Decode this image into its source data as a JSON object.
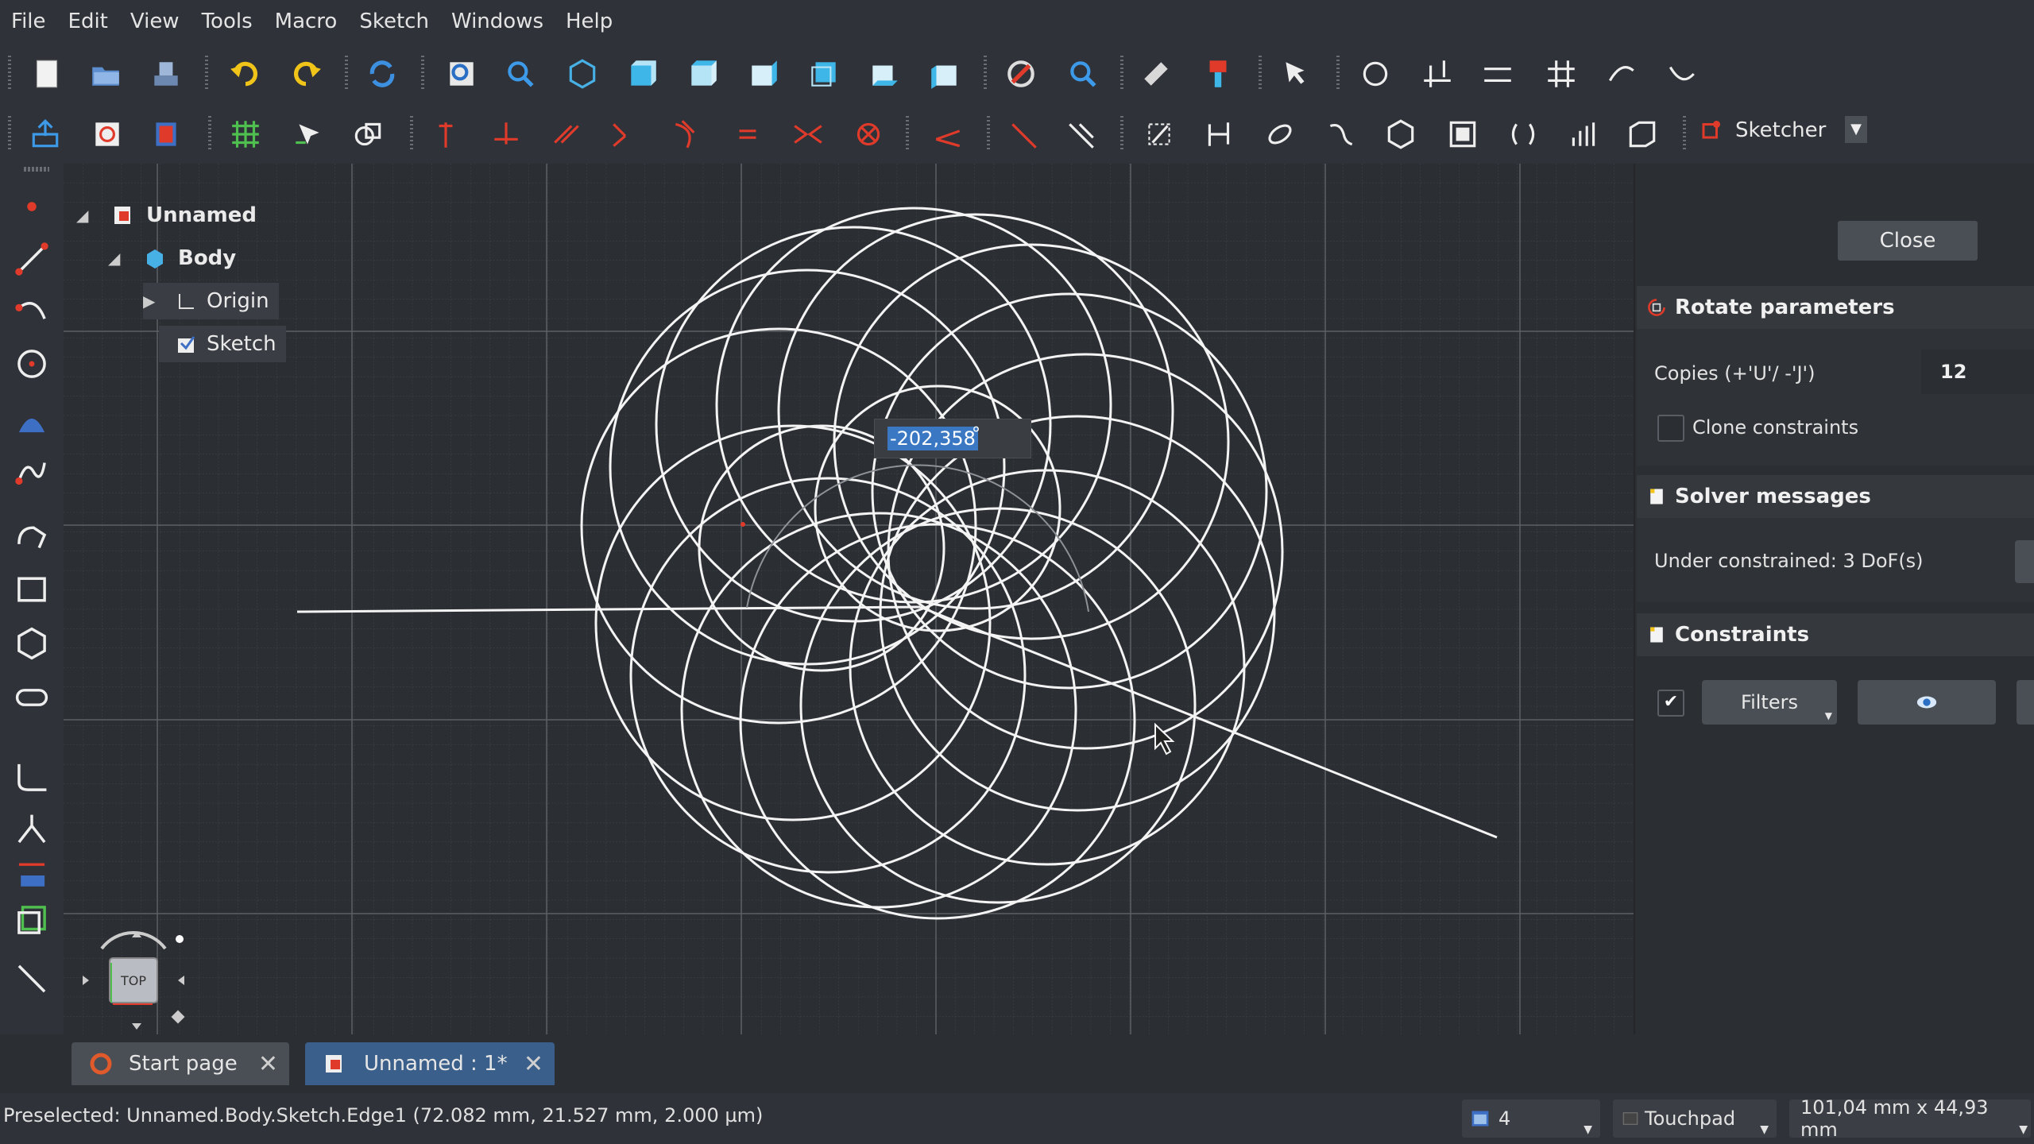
{
  "menubar": {
    "items": [
      "File",
      "Edit",
      "View",
      "Tools",
      "Macro",
      "Sketch",
      "Windows",
      "Help"
    ]
  },
  "toolbar": {
    "workbench": "Sketcher",
    "icons_row1": [
      "new-file-icon",
      "open-file-icon",
      "save-file-icon",
      "undo-icon",
      "redo-icon",
      "refresh-icon",
      "fit-all-icon",
      "fit-selection-icon",
      "isometric-view-icon",
      "front-view-icon",
      "top-view-icon",
      "right-view-icon",
      "rear-view-icon",
      "bottom-view-icon",
      "left-view-icon",
      "draw-style-icon",
      "bounding-box-icon",
      "measure-icon",
      "part-icon",
      "whats-this-icon",
      "constrain-icons"
    ],
    "icons_row2": [
      "leave-sketch-icon",
      "view-sketch-icon",
      "view-section-icon",
      "toggle-grid-icon",
      "toggle-snap-icon",
      "rendering-order-icon",
      "coincident-icon",
      "point-on-object-icon",
      "horizontal-icon",
      "vertical-icon",
      "parallel-icon",
      "perpendicular-icon",
      "tangent-icon",
      "equal-icon",
      "symmetric-icon",
      "block-icon",
      "lock-icon",
      "distance-icon",
      "radius-icon",
      "construction-icon",
      "select-icon",
      "symmetry-icon",
      "array-icon",
      "clone-icon",
      "copy-icon",
      "move-icon"
    ]
  },
  "tree": {
    "document": "Unnamed",
    "body": "Body",
    "origin": "Origin",
    "sketch": "Sketch"
  },
  "angle_input": {
    "value": "-202,358",
    "unit": "°"
  },
  "taskpanel": {
    "close_label": "Close",
    "rotate": {
      "title": "Rotate parameters",
      "copies_label": "Copies (+'U'/ -'J')",
      "copies_value": "12",
      "clone_label": "Clone constraints"
    },
    "solver": {
      "title": "Solver messages",
      "message": "Under constrained:  3 DoF(s)"
    },
    "constraints": {
      "title": "Constraints",
      "filters_label": "Filters"
    }
  },
  "tabs": [
    {
      "label": "Start page"
    },
    {
      "label": "Unnamed : 1*"
    }
  ],
  "status": {
    "text": "Preselected: Unnamed.Body.Sketch.Edge1 (72.082 mm, 21.527 mm, 2.000 µm)",
    "views": "4",
    "nav_style": "Touchpad",
    "dimensions": "101,04 mm x 44,93 mm"
  },
  "navcube": {
    "face": "TOP"
  }
}
